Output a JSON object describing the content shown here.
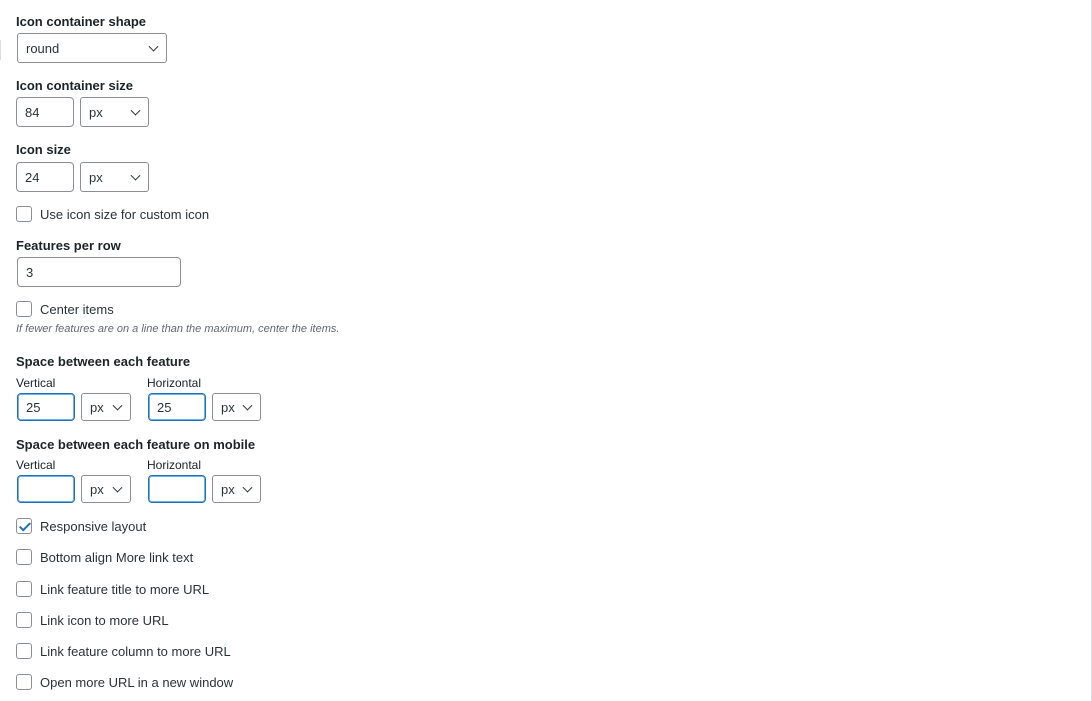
{
  "icon_container_shape": {
    "label": "Icon container shape",
    "value": "round"
  },
  "icon_container_size": {
    "label": "Icon container size",
    "value": "84",
    "unit": "px"
  },
  "icon_size": {
    "label": "Icon size",
    "value": "24",
    "unit": "px"
  },
  "use_icon_size_custom": {
    "label": "Use icon size for custom icon",
    "checked": false
  },
  "features_per_row": {
    "label": "Features per row",
    "value": "3"
  },
  "center_items": {
    "label": "Center items",
    "checked": false,
    "description": "If fewer features are on a line than the maximum, center the items."
  },
  "space_between": {
    "label": "Space between each feature",
    "vertical_label": "Vertical",
    "vertical_value": "25",
    "vertical_unit": "px",
    "horizontal_label": "Horizontal",
    "horizontal_value": "25",
    "horizontal_unit": "px"
  },
  "space_between_mobile": {
    "label": "Space between each feature on mobile",
    "vertical_label": "Vertical",
    "vertical_value": "",
    "vertical_unit": "px",
    "horizontal_label": "Horizontal",
    "horizontal_value": "",
    "horizontal_unit": "px"
  },
  "checkboxes": [
    {
      "label": "Responsive layout",
      "checked": true
    },
    {
      "label": "Bottom align More link text",
      "checked": false
    },
    {
      "label": "Link feature title to more URL",
      "checked": false
    },
    {
      "label": "Link icon to more URL",
      "checked": false
    },
    {
      "label": "Link feature column to more URL",
      "checked": false
    },
    {
      "label": "Open more URL in a new window",
      "checked": false
    }
  ],
  "colors": {
    "accent": "#2271b1",
    "border": "#8c8f94",
    "text": "#1d2327",
    "muted": "#646970"
  }
}
